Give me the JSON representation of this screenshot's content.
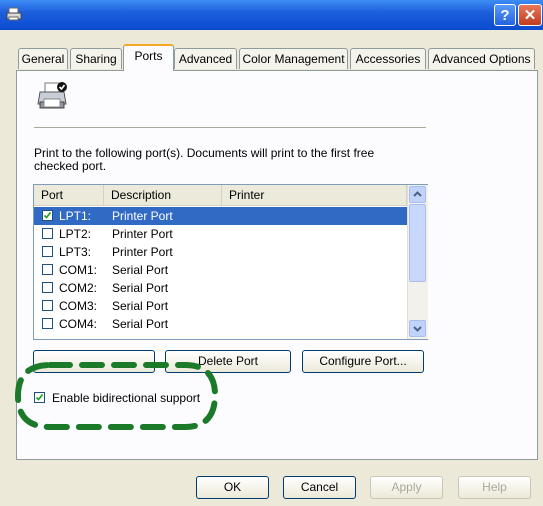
{
  "window": {
    "help_label": "?",
    "close_label": "✕"
  },
  "tabs": [
    {
      "label": "General"
    },
    {
      "label": "Sharing"
    },
    {
      "label": "Ports"
    },
    {
      "label": "Advanced"
    },
    {
      "label": "Color Management"
    },
    {
      "label": "Accessories"
    },
    {
      "label": "Advanced Options"
    }
  ],
  "ports_page": {
    "description": "Print to the following port(s). Documents will print to the first free checked port.",
    "columns": [
      "Port",
      "Description",
      "Printer"
    ],
    "rows": [
      {
        "port": "LPT1:",
        "description": "Printer Port",
        "checked": true,
        "selected": true
      },
      {
        "port": "LPT2:",
        "description": "Printer Port",
        "checked": false,
        "selected": false
      },
      {
        "port": "LPT3:",
        "description": "Printer Port",
        "checked": false,
        "selected": false
      },
      {
        "port": "COM1:",
        "description": "Serial Port",
        "checked": false,
        "selected": false
      },
      {
        "port": "COM2:",
        "description": "Serial Port",
        "checked": false,
        "selected": false
      },
      {
        "port": "COM3:",
        "description": "Serial Port",
        "checked": false,
        "selected": false
      },
      {
        "port": "COM4:",
        "description": "Serial Port",
        "checked": false,
        "selected": false
      }
    ],
    "add_port_label": "",
    "delete_port_label": "Delete Port",
    "configure_port_label": "Configure Port...",
    "bidirectional_label": "Enable bidirectional support",
    "bidirectional_checked": true
  },
  "footer": {
    "ok_label": "OK",
    "cancel_label": "Cancel",
    "apply_label": "Apply",
    "help_label": "Help"
  },
  "annotation": {
    "color": "#1a7a2a"
  }
}
